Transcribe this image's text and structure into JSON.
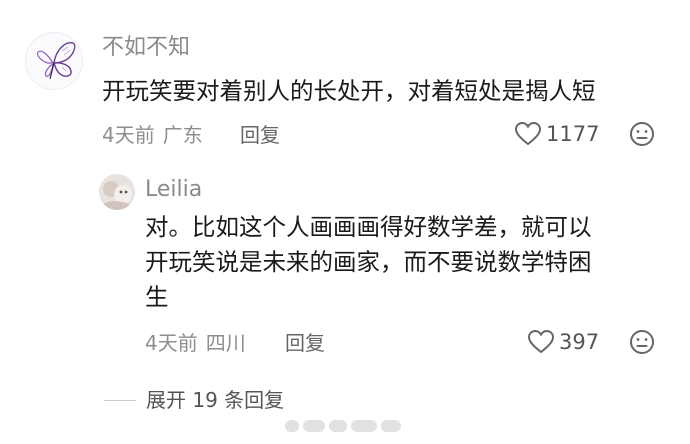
{
  "comment": {
    "username": "不如不知",
    "text": "开玩笑要对着别人的长处开，对着短处是揭人短",
    "time": "4天前",
    "location": "广东",
    "reply_label": "回复",
    "likes": "1177"
  },
  "reply": {
    "username": "Leilia",
    "text_lines": [
      "对。比如这个人画画画得好数学差，就可以",
      "开玩笑说是未来的画家，而不要说数学特困",
      "生"
    ],
    "time": "4天前",
    "location": "四川",
    "reply_label": "回复",
    "likes": "397"
  },
  "expand": {
    "label": "展开 19 条回复"
  },
  "colors": {
    "text_primary": "#1a1a1a",
    "text_secondary": "#8e8e8e",
    "icon": "#666666"
  }
}
